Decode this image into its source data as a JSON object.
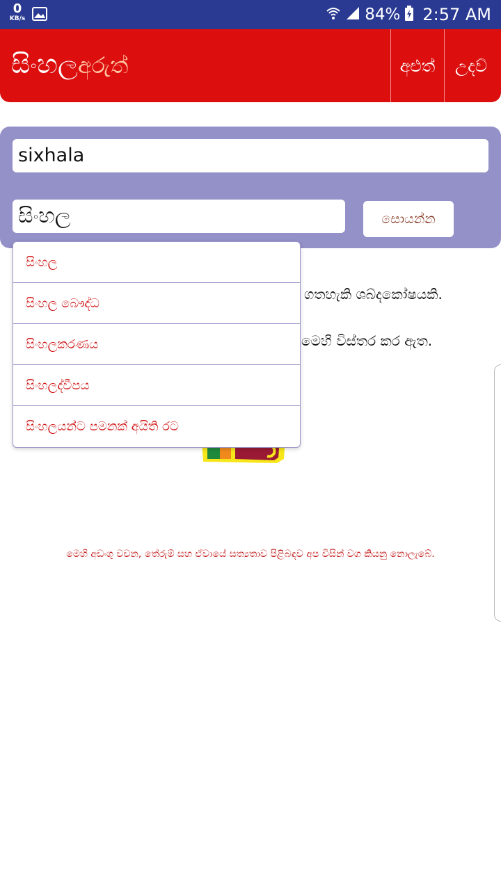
{
  "status_bar": {
    "net_speed": "0",
    "net_unit": "KB/s",
    "battery": "84%",
    "time": "2:57 AM",
    "icons": [
      "gallery-icon",
      "wifi-icon",
      "signal-icon",
      "battery-charging-icon"
    ]
  },
  "app_bar": {
    "brand_main": "සිංහල",
    "brand_sub": "අරුත්",
    "new_label": "අළුත්",
    "help_label": "උදව්"
  },
  "search": {
    "roman_value": "sixhala",
    "sinhala_value": "සිංහල",
    "button_label": "සොයන්න"
  },
  "content": {
    "line1": "ගතහැකි ශබ්දකෝෂයකි.",
    "line2": "මෙහි විස්තර කර ඇත."
  },
  "suggestions": [
    "සිංහල",
    "සිංහල බෞද්ධ",
    "සිංහලකරණය",
    "සිංහලද්වීපය",
    "සිංහලයන්ට පමනක් අයිති රට"
  ],
  "footer": {
    "disclaimer": "මෙහි අඩංගු වචන, තේරුම් සහ ඒවායේ සත්‍යතාව පිළිබඳව අප විසින් වග කියනු නොලැබේ."
  },
  "colors": {
    "status_bar": "#2a3a93",
    "app_bar": "#dc0e0e",
    "search_panel": "#9490c8",
    "suggestion_text": "#d01515"
  }
}
